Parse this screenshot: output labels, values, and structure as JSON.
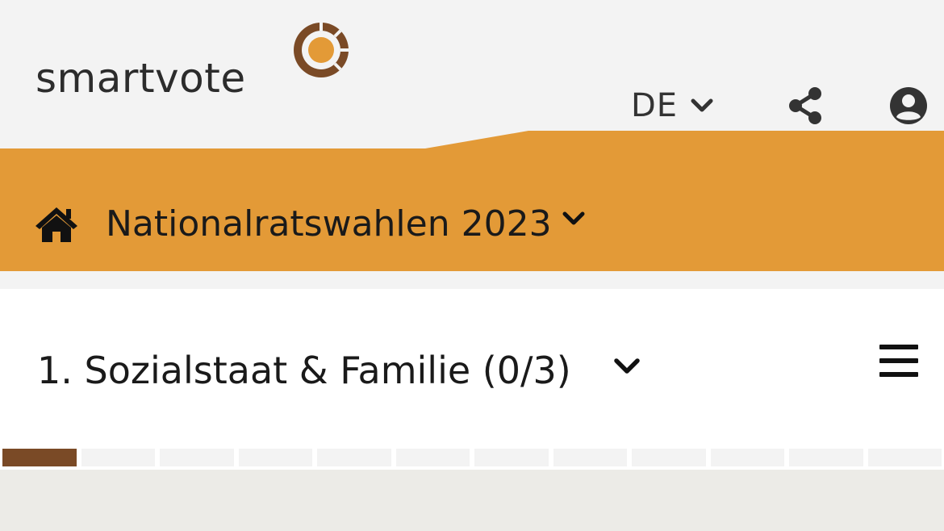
{
  "header": {
    "brand": "smartvote",
    "language": "DE"
  },
  "nav": {
    "election_title": "Nationalratswahlen 2023"
  },
  "topic": {
    "title": "1. Sozialstaat & Familie (0/3)"
  },
  "progress": {
    "segments": 12,
    "active": 1
  },
  "colors": {
    "accent_orange": "#e39a37",
    "brand_brown": "#7a4a26",
    "header_bg": "#f3f3f3",
    "page_bg": "#ecebe7"
  },
  "icons": [
    "smartvote-logo-icon",
    "chevron-down-icon",
    "share-icon",
    "user-icon",
    "home-icon",
    "hamburger-menu-icon"
  ]
}
